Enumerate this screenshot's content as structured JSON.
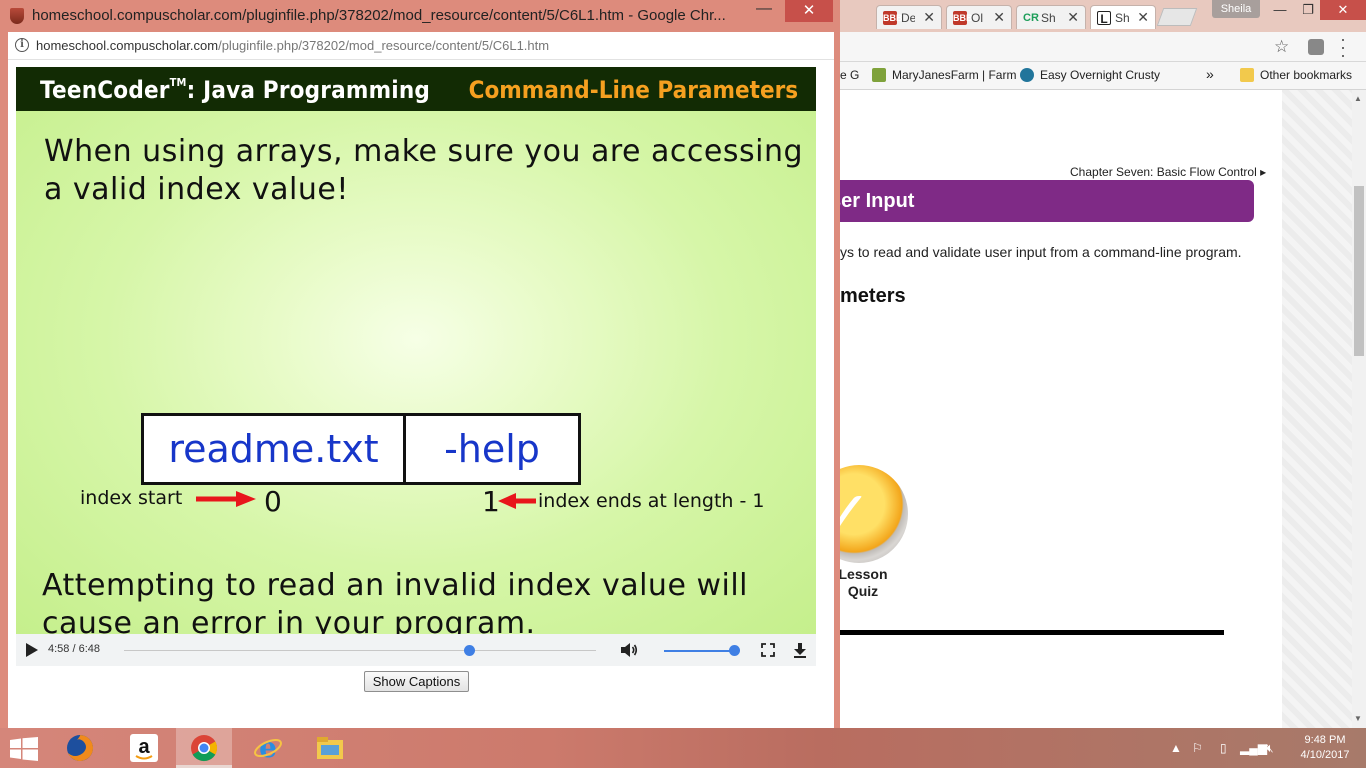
{
  "popup": {
    "title": "homeschool.compuscholar.com/pluginfile.php/378202/mod_resource/content/5/C6L1.htm - Google Chr...",
    "url_host": "homeschool.compuscholar.com",
    "url_path": "/pluginfile.php/378202/mod_resource/content/5/C6L1.htm",
    "minimize_label": "—",
    "close_label": "✕"
  },
  "slide": {
    "brand": "TeenCoder",
    "brand_tm": "TM",
    "brand_rest": ": Java Programming",
    "topic": "Command-Line Parameters",
    "body1": "When using arrays, make sure you are accessing a valid index value!",
    "array_items": [
      "readme.txt",
      "-help"
    ],
    "index_start_label": "index start",
    "index_start_value": "0",
    "index_end_value": "1",
    "index_end_label": "index ends at length - 1",
    "body2": "Attempting to read an invalid index value will cause an error in your program."
  },
  "player": {
    "time_current": "4:58",
    "time_total": "6:48",
    "progress_fraction": 0.73,
    "volume_fraction": 1.0
  },
  "captions_button": "Show Captions",
  "background": {
    "tabs": [
      {
        "label": "De",
        "favicon": "BBB",
        "color": "#c0392b"
      },
      {
        "label": "Ol",
        "favicon": "BBB",
        "color": "#c0392b"
      },
      {
        "label": "Sh",
        "favicon": "CR",
        "color": "#1e9e5a"
      },
      {
        "label": "Sh",
        "favicon": "L",
        "color": "#222222"
      }
    ],
    "user": "Sheila",
    "bookmarks": [
      {
        "label": "e G",
        "icon_color": "#cccccc"
      },
      {
        "label": "MaryJanesFarm | Farm",
        "icon_color": "#7fa23b"
      },
      {
        "label": "Easy Overnight Crusty",
        "icon_color": "#21759b"
      }
    ],
    "bookmarks_overflow": "»",
    "other_bookmarks": "Other bookmarks",
    "breadcrumb": "Chapter Seven: Basic Flow Control ▸",
    "banner_title": "ser Input",
    "description": "ys to read and validate user input from a command-line program.",
    "heading": "meters",
    "quiz_label_line1": "Lesson",
    "quiz_label_line2": "Quiz"
  },
  "taskbar": {
    "time": "9:48 PM",
    "date": "4/10/2017",
    "apps": [
      "firefox",
      "amazon",
      "chrome",
      "internet-explorer",
      "file-explorer"
    ],
    "amazon_glyph": "a"
  },
  "colors": {
    "accent_purple": "#7f2a86",
    "slide_header": "#122b04",
    "slide_topic": "#f5a020",
    "array_text": "#1736c9",
    "player_blue": "#3f7fe4",
    "popup_frame": "#dd8b7c"
  }
}
